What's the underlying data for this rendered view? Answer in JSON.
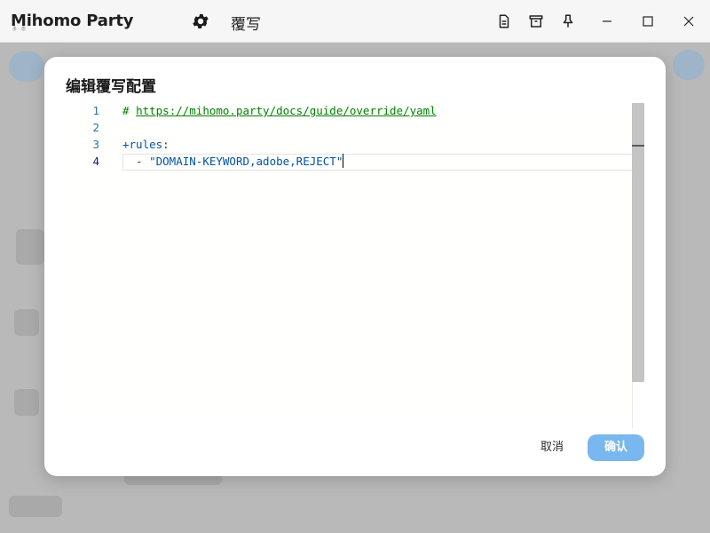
{
  "titlebar": {
    "app_name": "Mihomo Party",
    "app_sub": "多 · 态",
    "page_title": "覆写",
    "icons": [
      "settings-icon",
      "file-text-icon",
      "archive-icon",
      "pin-icon",
      "minimize-icon",
      "maximize-icon",
      "close-icon"
    ]
  },
  "modal": {
    "title": "编辑覆写配置",
    "editor": {
      "lines": [
        {
          "num": "1",
          "comment_prefix": "# ",
          "link": "https://mihomo.party/docs/guide/override/yaml"
        },
        {
          "num": "2"
        },
        {
          "num": "3",
          "key": "+rules",
          "colon": ":"
        },
        {
          "num": "4",
          "dash": "  - ",
          "string": "\"DOMAIN-KEYWORD,adobe,REJECT\""
        }
      ]
    },
    "cancel_label": "取消",
    "confirm_label": "确认"
  },
  "colors": {
    "accent": "#79b8ee",
    "comment": "#008000",
    "string": "#0451a5",
    "line_number": "#237893"
  }
}
